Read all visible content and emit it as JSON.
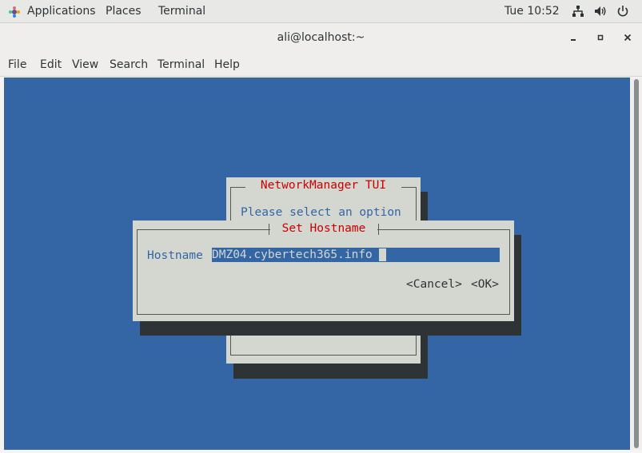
{
  "topbar": {
    "applications": "Applications",
    "places": "Places",
    "terminal": "Terminal",
    "clock": "Tue 10:52",
    "icons": [
      "applications-icon",
      "network-icon",
      "volume-icon",
      "power-icon"
    ]
  },
  "window": {
    "title": "ali@localhost:~"
  },
  "menubar": {
    "items": [
      "File",
      "Edit",
      "View",
      "Search",
      "Terminal",
      "Help"
    ]
  },
  "tui": {
    "main_title": "NetworkManager TUI",
    "main_prompt": "Please select an option",
    "dialog": {
      "title": "Set Hostname",
      "hostname_label": "Hostname",
      "hostname_value": "DMZ04.cybertech365.info",
      "cancel_label": "<Cancel>",
      "ok_label": "<OK>"
    }
  },
  "colors": {
    "terminal_bg": "#3465a4",
    "dialog_bg": "#d3d7cf",
    "title_red": "#cc0000",
    "label_blue": "#3465a4",
    "shadow": "#2e3436"
  }
}
